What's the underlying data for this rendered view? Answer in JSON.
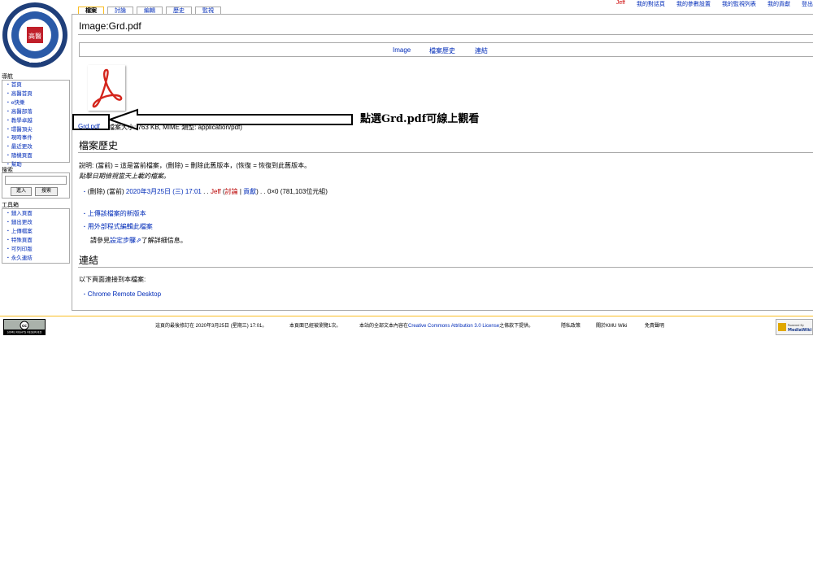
{
  "personal": {
    "user": "Jeff",
    "items": [
      "我的對話頁",
      "我的參數設置",
      "我的監視列表",
      "我的貢獻",
      "登出"
    ]
  },
  "tabs": [
    {
      "label": "檔案",
      "selected": true
    },
    {
      "label": "討論",
      "selected": false
    },
    {
      "label": "編輯",
      "selected": false
    },
    {
      "label": "歷史",
      "selected": false
    },
    {
      "label": "監視",
      "selected": false
    }
  ],
  "logo": {
    "text": "KAOHSIUNG MEDICAL UNIVERSITY",
    "center": "高醫",
    "year": "1954"
  },
  "sidebar": {
    "nav_title": "導航",
    "nav_items": [
      "首頁",
      "高醫首頁",
      "e快樂",
      "高醫部落",
      "教學卓越",
      "環醫頂尖",
      "現時事件",
      "最近更改",
      "隨機頁面",
      "幫助"
    ],
    "search_title": "搜索",
    "search_placeholder": "",
    "go_label": "進入",
    "search_label": "搜索",
    "toolbox_title": "工具箱",
    "toolbox_items": [
      "鏈入頁面",
      "鏈出更改",
      "上傳檔案",
      "特殊頁面",
      "可列印版",
      "永久連結"
    ]
  },
  "page": {
    "title": "Image:Grd.pdf",
    "toc": [
      "Image",
      "檔案歷史",
      "連結"
    ],
    "file_link": "Grd.pdf",
    "file_info": "檔案大小: 763 KB, MIME 類型: application/pdf)",
    "annotation": "點選Grd.pdf可線上觀看",
    "history_heading": "檔案歷史",
    "legend": "說明: (當前) = 這是當前檔案，(刪除) = 刪除此舊版本，(恢復 = 恢復到此舊版本。",
    "legend_hint": "點擊日期檢視當天上載的檔案。",
    "history_row": {
      "delete": "(刪除)",
      "current": "(當前)",
      "date": "2020年3月25日 (三) 17:01",
      "sep": ". .",
      "user": "Jeff",
      "talk": "討論",
      "contribs": "貢獻",
      "size": ". . 0×0 (781,103位元組)"
    },
    "upload_new": "上傳該檔案的新版本",
    "edit_external": "用外部程式編輯此檔案",
    "see_setup_prefix": "請參見",
    "see_setup_link": "設定步驟",
    "see_setup_suffix": "了解詳細信息。",
    "links_heading": "連結",
    "links_intro": "以下頁面連接到本檔案:",
    "linked_pages": [
      "Chrome Remote Desktop"
    ]
  },
  "footer": {
    "cc_label": "SOME RIGHTS RESERVED",
    "last_modified": "這頁的最後修訂在 2020年3月25日 (星期三) 17:01。",
    "views": "本頁面已經被瀏覽1次。",
    "license_prefix": "本站的全部文本內容在",
    "license_link": "Creative Commons Attribution 3.0 License",
    "license_suffix": "之條款下提供。",
    "privacy": "隱私政策",
    "about": "關於KMU Wiki",
    "disclaimer": "免責聲明",
    "powered": "Powered By MediaWiki"
  }
}
